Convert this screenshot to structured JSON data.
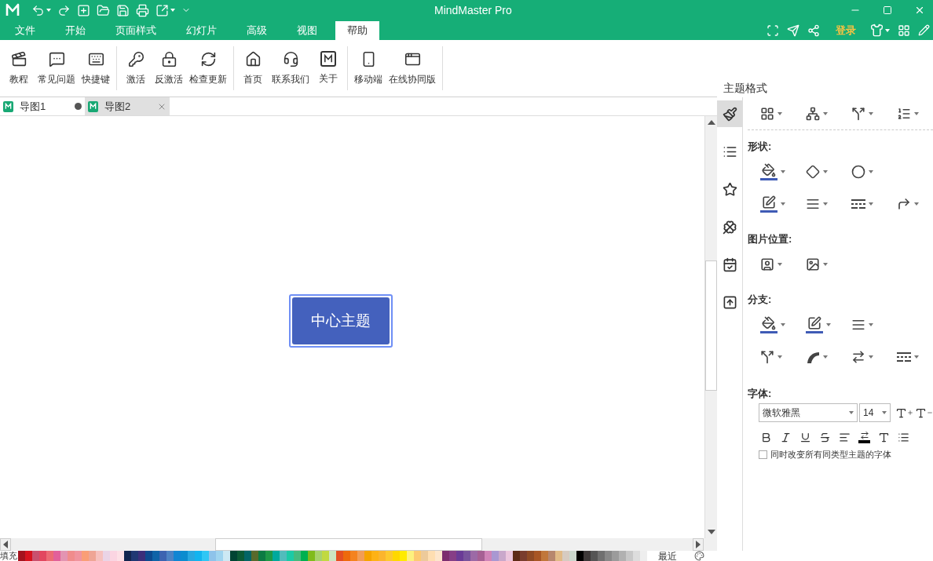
{
  "window": {
    "title": "MindMaster Pro"
  },
  "quick_access": [
    {
      "kind": "undo",
      "dropdown": true
    },
    {
      "kind": "redo",
      "dropdown": false
    },
    {
      "kind": "new",
      "dropdown": false
    },
    {
      "kind": "open",
      "dropdown": false
    },
    {
      "kind": "save",
      "dropdown": false
    },
    {
      "kind": "print",
      "dropdown": false
    },
    {
      "kind": "export",
      "dropdown": true
    },
    {
      "kind": "more",
      "dropdown": false
    }
  ],
  "menu_tabs": [
    {
      "label": "文件",
      "selected": false
    },
    {
      "label": "开始",
      "selected": false
    },
    {
      "label": "页面样式",
      "selected": false
    },
    {
      "label": "幻灯片",
      "selected": false
    },
    {
      "label": "高级",
      "selected": false
    },
    {
      "label": "视图",
      "selected": false
    },
    {
      "label": "帮助",
      "selected": true
    }
  ],
  "login": "登录",
  "ribbon_groups": [
    [
      {
        "label": "教程",
        "kind": "video"
      },
      {
        "label": "常见问题",
        "kind": "faq"
      },
      {
        "label": "快捷键",
        "kind": "keyboard"
      }
    ],
    [
      {
        "label": "激活",
        "kind": "key"
      },
      {
        "label": "反激活",
        "kind": "lock"
      },
      {
        "label": "检查更新",
        "kind": "update"
      }
    ],
    [
      {
        "label": "首页",
        "kind": "home"
      },
      {
        "label": "联系我们",
        "kind": "headset"
      },
      {
        "label": "关于",
        "kind": "logo"
      }
    ],
    [
      {
        "label": "移动端",
        "kind": "phone"
      },
      {
        "label": "在线协同版",
        "kind": "browser"
      }
    ]
  ],
  "doc_tabs": [
    {
      "label": "导图1",
      "selected": false,
      "modified": true
    },
    {
      "label": "导图2",
      "selected": true,
      "modified": false
    }
  ],
  "central_topic": "中心主题",
  "panel": {
    "title": "主题格式",
    "side_icons": [
      {
        "kind": "brush",
        "selected": true
      },
      {
        "kind": "list",
        "selected": false
      },
      {
        "kind": "star",
        "selected": false
      },
      {
        "kind": "clover",
        "selected": false
      },
      {
        "kind": "calendar",
        "selected": false
      },
      {
        "kind": "upload",
        "selected": false
      }
    ],
    "top_row": [
      {
        "kind": "grid"
      },
      {
        "kind": "org"
      },
      {
        "kind": "branch"
      },
      {
        "kind": "numbered"
      }
    ],
    "sections": [
      {
        "label": "形状:",
        "rows": [
          [
            {
              "kind": "fill",
              "color": "#3f5bb5"
            },
            {
              "kind": "shape"
            },
            {
              "kind": "shadow"
            }
          ],
          [
            {
              "kind": "pen",
              "color": "#3f5bb5"
            },
            {
              "kind": "lines"
            },
            {
              "kind": "dashes"
            },
            {
              "kind": "corner"
            }
          ]
        ]
      },
      {
        "label": "图片位置:",
        "rows": [
          [
            {
              "kind": "picture-left"
            },
            {
              "kind": "picture-frame"
            }
          ]
        ]
      },
      {
        "label": "分支:",
        "rows": [
          [
            {
              "kind": "fill",
              "color": "#3f5bb5"
            },
            {
              "kind": "pen",
              "color": "#3f5bb5"
            },
            {
              "kind": "lines"
            }
          ],
          [
            {
              "kind": "branch"
            },
            {
              "kind": "curve"
            },
            {
              "kind": "arrow-lines"
            },
            {
              "kind": "dashes"
            }
          ]
        ]
      }
    ],
    "font_label": "字体:",
    "font_family": "微软雅黑",
    "font_size": "14",
    "sync_label": "同时改变所有同类型主题的字体",
    "sync_checked": false
  },
  "palette": {
    "label": "填充",
    "recent": "最近",
    "swatches": [
      {
        "color": "#a5131e"
      },
      {
        "color": "#d7141f"
      },
      {
        "color": "#c9506e"
      },
      {
        "color": "#e2475f"
      },
      {
        "color": "#ec6a73"
      },
      {
        "color": "#e2609a"
      },
      {
        "color": "#e394b2"
      },
      {
        "color": "#f08c8c"
      },
      {
        "color": "#f0949e"
      },
      {
        "color": "#fa9e76"
      },
      {
        "color": "#efa595"
      },
      {
        "color": "#f6c1be"
      },
      {
        "color": "#ead4e6"
      },
      {
        "color": "#fbd5e2"
      },
      {
        "color": "#fde0e6"
      },
      {
        "color": "#13254f"
      },
      {
        "color": "#1f3873"
      },
      {
        "color": "#3a2e7a"
      },
      {
        "color": "#0d4a8f"
      },
      {
        "color": "#0f64a8"
      },
      {
        "color": "#3c63b1"
      },
      {
        "color": "#4d82c4"
      },
      {
        "color": "#1185d3"
      },
      {
        "color": "#0b8ccf"
      },
      {
        "color": "#27a8e0"
      },
      {
        "color": "#12b4ef"
      },
      {
        "color": "#2fc7f5"
      },
      {
        "color": "#8ec3ea"
      },
      {
        "color": "#9fd4ef"
      },
      {
        "color": "#cde9f4"
      },
      {
        "color": "#004433"
      },
      {
        "color": "#0b5a35"
      },
      {
        "color": "#036566"
      },
      {
        "color": "#596a2c"
      },
      {
        "color": "#0c7b43"
      },
      {
        "color": "#1e9846"
      },
      {
        "color": "#00a99d"
      },
      {
        "color": "#51bcbc"
      },
      {
        "color": "#1ccaa6"
      },
      {
        "color": "#45bb7e"
      },
      {
        "color": "#00b050"
      },
      {
        "color": "#80bb1c"
      },
      {
        "color": "#a7d26b"
      },
      {
        "color": "#c1d941"
      },
      {
        "color": "#cde4c2"
      },
      {
        "color": "#e44f22"
      },
      {
        "color": "#ee6a0c"
      },
      {
        "color": "#f4831f"
      },
      {
        "color": "#f29d55"
      },
      {
        "color": "#f6a400"
      },
      {
        "color": "#feb215"
      },
      {
        "color": "#fbb52e"
      },
      {
        "color": "#fdc92f"
      },
      {
        "color": "#ffd800"
      },
      {
        "color": "#ffeb00"
      },
      {
        "color": "#fdf17e"
      },
      {
        "color": "#fdca71"
      },
      {
        "color": "#edca9a"
      },
      {
        "color": "#fedeb1"
      },
      {
        "color": "#fde6cc"
      },
      {
        "color": "#7c2e6f"
      },
      {
        "color": "#863e86"
      },
      {
        "color": "#6a3b96"
      },
      {
        "color": "#78539c"
      },
      {
        "color": "#9c6aa6"
      },
      {
        "color": "#a66094"
      },
      {
        "color": "#d084b8"
      },
      {
        "color": "#a998d2"
      },
      {
        "color": "#c9a8cb"
      },
      {
        "color": "#ecc6dd"
      },
      {
        "color": "#5e2a16"
      },
      {
        "color": "#7a3d2e"
      },
      {
        "color": "#8f4a25"
      },
      {
        "color": "#a85625"
      },
      {
        "color": "#c1773b"
      },
      {
        "color": "#b7876d"
      },
      {
        "color": "#e1ba86"
      },
      {
        "color": "#d6cbc1"
      },
      {
        "color": "#cbd7cd"
      },
      {
        "color": "#000000"
      },
      {
        "color": "#3d3838"
      },
      {
        "color": "#555555"
      },
      {
        "color": "#707070"
      },
      {
        "color": "#888888"
      },
      {
        "color": "#9b9b9b"
      },
      {
        "color": "#b1b1b1"
      },
      {
        "color": "#c8c8c8"
      },
      {
        "color": "#dddddd"
      },
      {
        "color": "#eeeeee"
      }
    ]
  }
}
